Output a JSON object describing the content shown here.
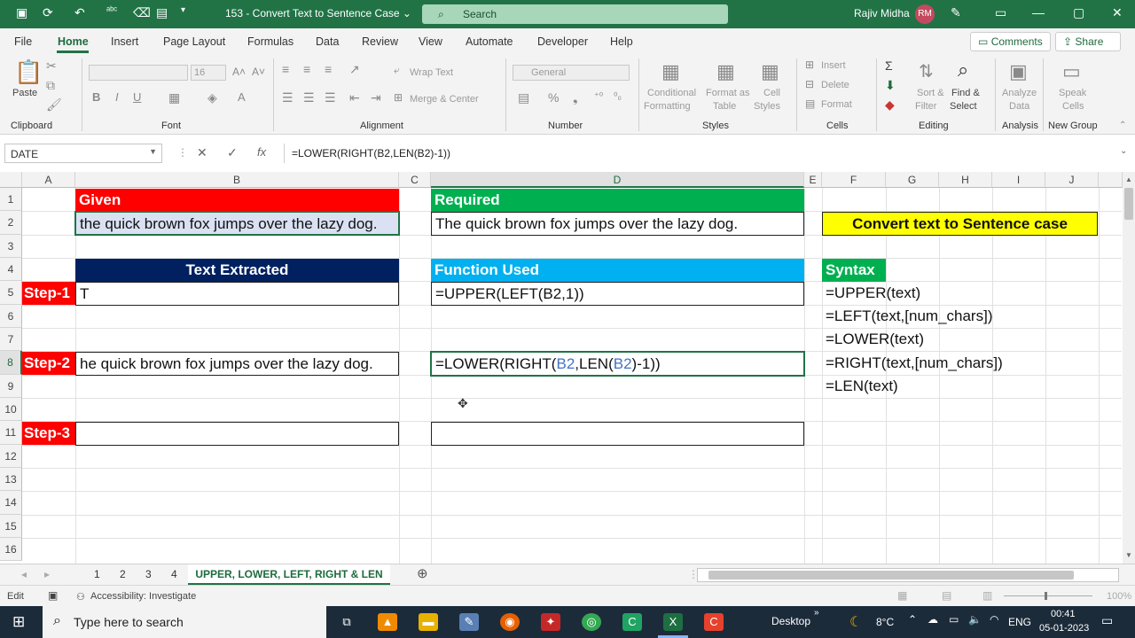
{
  "titlebar": {
    "doc_title": "153 - Convert Text to Sentence Case ⌄",
    "search_placeholder": "Search",
    "user_name": "Rajiv Midha",
    "user_initials": "RM"
  },
  "menu": {
    "file": "File",
    "home": "Home",
    "insert": "Insert",
    "page_layout": "Page Layout",
    "formulas": "Formulas",
    "data": "Data",
    "review": "Review",
    "view": "View",
    "automate": "Automate",
    "developer": "Developer",
    "help": "Help",
    "comments": "Comments",
    "share": "Share"
  },
  "ribbon": {
    "paste": "Paste",
    "clipboard": "Clipboard",
    "font_size": "16",
    "font": "Font",
    "wrap_text": "Wrap Text",
    "merge_center": "Merge & Center",
    "alignment": "Alignment",
    "number_format": "General",
    "number": "Number",
    "conditional_1": "Conditional",
    "conditional_2": "Formatting",
    "format_as_1": "Format as",
    "format_as_2": "Table",
    "cell_styles_1": "Cell",
    "cell_styles_2": "Styles",
    "styles": "Styles",
    "insert": "Insert",
    "delete": "Delete",
    "format": "Format",
    "cells": "Cells",
    "sort_1": "Sort &",
    "sort_2": "Filter",
    "find_1": "Find &",
    "find_2": "Select",
    "editing": "Editing",
    "analyze_1": "Analyze",
    "analyze_2": "Data",
    "analysis": "Analysis",
    "speak_1": "Speak",
    "speak_2": "Cells",
    "new_group": "New Group"
  },
  "formula_bar": {
    "name_box": "DATE",
    "formula": "=LOWER(RIGHT(B2,LEN(B2)-1))"
  },
  "columns": [
    "A",
    "B",
    "C",
    "D",
    "E",
    "F",
    "G",
    "H",
    "I",
    "J"
  ],
  "rows": [
    "1",
    "2",
    "3",
    "4",
    "5",
    "6",
    "7",
    "8",
    "9",
    "10",
    "11",
    "12",
    "13",
    "14",
    "15",
    "16"
  ],
  "cells": {
    "B1": "Given",
    "D1": "Required",
    "B2": "the quick brown fox jumps over the lazy dog.",
    "D2": "The quick brown fox jumps over the lazy dog.",
    "F2": "Convert text to Sentence case",
    "B4": "Text Extracted",
    "D4": "Function Used",
    "F4": "Syntax",
    "A5": "Step-1",
    "B5": "T",
    "D5": "=UPPER(LEFT(B2,1))",
    "F5": "=UPPER(text)",
    "F6": "=LEFT(text,[num_chars])",
    "F7": "=LOWER(text)",
    "A8": "Step-2",
    "B8": "he quick brown fox jumps over the lazy dog.",
    "D8_parts": [
      "=LOWER(RIGHT(",
      "B2",
      ",LEN(",
      "B2",
      ")-1))"
    ],
    "F8": "=RIGHT(text,[num_chars])",
    "F9": "=LEN(text)",
    "A11": "Step-3"
  },
  "sheets": [
    "1",
    "2",
    "3",
    "4"
  ],
  "active_sheet": "UPPER, LOWER, LEFT, RIGHT & LEN",
  "status": {
    "mode": "Edit",
    "accessibility": "Accessibility: Investigate",
    "zoom": "100%"
  },
  "taskbar": {
    "search_placeholder": "Type here to search",
    "desktop": "Desktop",
    "temperature": "8°C",
    "language": "ENG",
    "time": "00:41",
    "date": "05-01-2023"
  }
}
